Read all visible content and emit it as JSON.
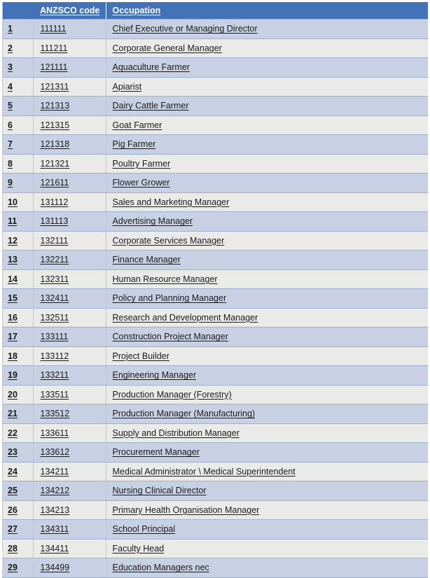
{
  "table": {
    "columns": [
      {
        "key": "num",
        "label": ""
      },
      {
        "key": "code",
        "label": "ANZSCO code"
      },
      {
        "key": "occ",
        "label": "Occupation"
      }
    ],
    "header": {
      "num_label": "",
      "code_label": "ANZSCO code",
      "occupation_label": "Occupation"
    },
    "colors": {
      "header_background": "#4472b8",
      "header_text": "#ffffff",
      "row_odd_background": "#c7d1e3",
      "row_even_background": "#eaeae8",
      "row_text": "#1a1a1a",
      "grid_line": "#9db0d0",
      "page_background": "#ffffff"
    },
    "rows": [
      {
        "num": "1",
        "code": "111111",
        "occ": "Chief Executive or Managing Director"
      },
      {
        "num": "2",
        "code": "111211",
        "occ": "Corporate General Manager"
      },
      {
        "num": "3",
        "code": "121111",
        "occ": "Aquaculture Farmer"
      },
      {
        "num": "4",
        "code": "121311",
        "occ": "Apiarist"
      },
      {
        "num": "5",
        "code": "121313",
        "occ": "Dairy Cattle Farmer"
      },
      {
        "num": "6",
        "code": "121315",
        "occ": "Goat Farmer"
      },
      {
        "num": "7",
        "code": "121318",
        "occ": "Pig Farmer"
      },
      {
        "num": "8",
        "code": "121321",
        "occ": "Poultry Farmer"
      },
      {
        "num": "9",
        "code": "121611",
        "occ": "Flower Grower"
      },
      {
        "num": "10",
        "code": "131112",
        "occ": "Sales and Marketing Manager"
      },
      {
        "num": "11",
        "code": "131113",
        "occ": "Advertising Manager"
      },
      {
        "num": "12",
        "code": "132111",
        "occ": "Corporate Services Manager"
      },
      {
        "num": "13",
        "code": "132211",
        "occ": "Finance Manager"
      },
      {
        "num": "14",
        "code": "132311",
        "occ": "Human Resource Manager"
      },
      {
        "num": "15",
        "code": "132411",
        "occ": "Policy and Planning Manager"
      },
      {
        "num": "16",
        "code": "132511",
        "occ": "Research and Development Manager"
      },
      {
        "num": "17",
        "code": "133111",
        "occ": "Construction Project Manager"
      },
      {
        "num": "18",
        "code": "133112",
        "occ": "Project Builder"
      },
      {
        "num": "19",
        "code": "133211",
        "occ": "Engineering Manager"
      },
      {
        "num": "20",
        "code": "133511",
        "occ": "Production Manager (Forestry)"
      },
      {
        "num": "21",
        "code": "133512",
        "occ": "Production Manager (Manufacturing)"
      },
      {
        "num": "22",
        "code": "133611",
        "occ": "Supply and Distribution Manager"
      },
      {
        "num": "23",
        "code": "133612",
        "occ": "Procurement Manager"
      },
      {
        "num": "24",
        "code": "134211",
        "occ": "Medical Administrator \\ Medical Superintendent"
      },
      {
        "num": "25",
        "code": "134212",
        "occ": "Nursing Clinical Director"
      },
      {
        "num": "26",
        "code": "134213",
        "occ": "Primary Health Organisation Manager"
      },
      {
        "num": "27",
        "code": "134311",
        "occ": "School Principal"
      },
      {
        "num": "28",
        "code": "134411",
        "occ": "Faculty Head"
      },
      {
        "num": "29",
        "code": "134499",
        "occ": "Education Managers nec"
      }
    ]
  }
}
